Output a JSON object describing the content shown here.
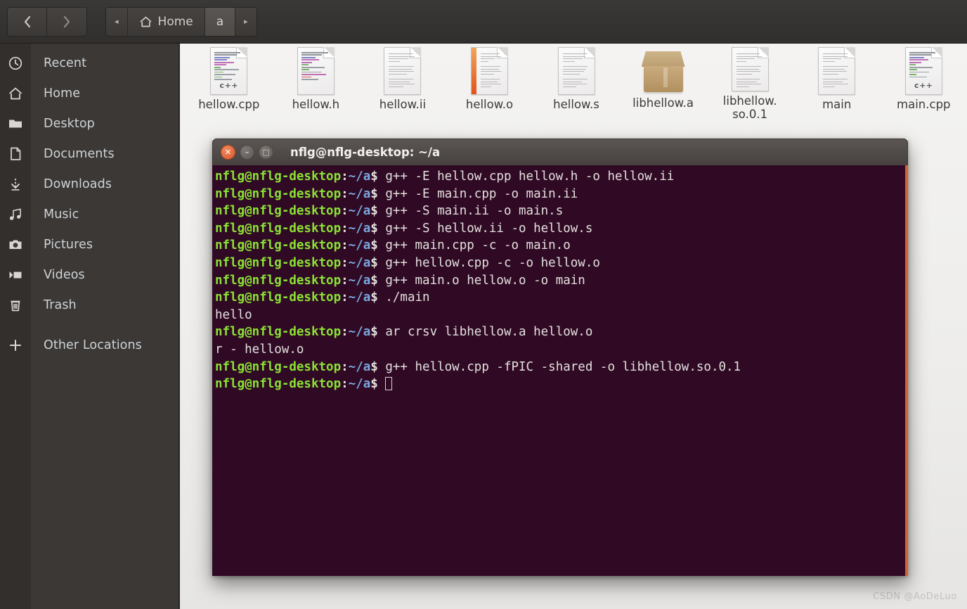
{
  "window": {
    "titlebar_back_icon": "chevron-left-icon",
    "titlebar_forward_icon": "chevron-right-icon"
  },
  "header": {
    "back_label": "‹",
    "forward_label": "›",
    "path_prev_label": "◂",
    "path_next_label": "▸",
    "home_label": "Home",
    "current_label": "a"
  },
  "sidebar": {
    "items": [
      {
        "label": "Recent",
        "icon": "clock-icon"
      },
      {
        "label": "Home",
        "icon": "home-icon"
      },
      {
        "label": "Desktop",
        "icon": "folder-icon"
      },
      {
        "label": "Documents",
        "icon": "document-icon"
      },
      {
        "label": "Downloads",
        "icon": "download-icon"
      },
      {
        "label": "Music",
        "icon": "music-note-icon"
      },
      {
        "label": "Pictures",
        "icon": "camera-icon"
      },
      {
        "label": "Videos",
        "icon": "video-icon"
      },
      {
        "label": "Trash",
        "icon": "trash-icon"
      },
      {
        "label": "Other Locations",
        "icon": "plus-icon"
      }
    ]
  },
  "files": [
    {
      "name": "hellow.cpp",
      "icon": "cpp-source-file-icon"
    },
    {
      "name": "hellow.h",
      "icon": "cpp-header-file-icon"
    },
    {
      "name": "hellow.ii",
      "icon": "text-file-icon"
    },
    {
      "name": "hellow.o",
      "icon": "object-file-icon"
    },
    {
      "name": "hellow.s",
      "icon": "text-file-icon"
    },
    {
      "name": "libhellow.a",
      "icon": "package-archive-icon"
    },
    {
      "name": "libhellow.\nso.0.1",
      "icon": "text-file-icon"
    },
    {
      "name": "main",
      "icon": "text-file-icon"
    },
    {
      "name": "main.cpp",
      "icon": "cpp-source-file-icon"
    }
  ],
  "terminal": {
    "title": "nflg@nflg-desktop: ~/a",
    "close_label": "✕",
    "minimize_label": "–",
    "maximize_label": "□",
    "prompt": {
      "user_host": "nflg@nflg-desktop",
      "colon": ":",
      "path": "~/a",
      "dollar": "$"
    },
    "colors": {
      "background": "#300a24",
      "user_host": "#8ae234",
      "path": "#7aa7e0",
      "text": "#e4e1df",
      "accent_border": "#d4622c"
    },
    "lines": [
      {
        "type": "prompt",
        "command": " g++ -E hellow.cpp hellow.h -o hellow.ii"
      },
      {
        "type": "prompt",
        "command": " g++ -E main.cpp -o main.ii"
      },
      {
        "type": "prompt",
        "command": " g++ -S main.ii -o main.s"
      },
      {
        "type": "prompt",
        "command": " g++ -S hellow.ii -o hellow.s"
      },
      {
        "type": "prompt",
        "command": " g++ main.cpp -c -o main.o"
      },
      {
        "type": "prompt",
        "command": " g++ hellow.cpp -c -o hellow.o"
      },
      {
        "type": "prompt",
        "command": " g++ main.o hellow.o -o main"
      },
      {
        "type": "prompt",
        "command": " ./main"
      },
      {
        "type": "output",
        "text": "hello"
      },
      {
        "type": "prompt",
        "command": " ar crsv libhellow.a hellow.o"
      },
      {
        "type": "output",
        "text": "r - hellow.o"
      },
      {
        "type": "prompt",
        "command": " g++ hellow.cpp -fPIC -shared -o libhellow.so.0.1"
      },
      {
        "type": "prompt-cursor",
        "command": " "
      }
    ]
  },
  "watermark": {
    "text": "CSDN @AoDeLuo"
  }
}
